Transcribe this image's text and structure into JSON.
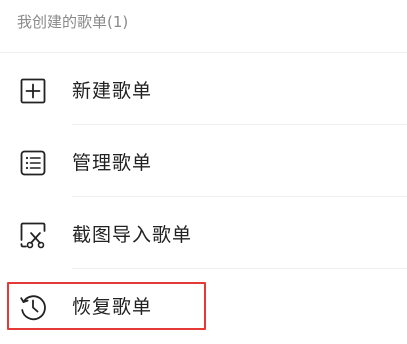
{
  "section": {
    "header": "我创建的歌单(1)"
  },
  "menu": {
    "items": [
      {
        "icon": "plus-square-icon",
        "label": "新建歌单"
      },
      {
        "icon": "list-manage-icon",
        "label": "管理歌单"
      },
      {
        "icon": "screenshot-scissors-icon",
        "label": "截图导入歌单"
      },
      {
        "icon": "restore-clock-icon",
        "label": "恢复歌单"
      }
    ]
  },
  "colors": {
    "text": "#222222",
    "muted": "#8a8a8a",
    "divider": "#efefef",
    "highlight": "#e53935"
  }
}
